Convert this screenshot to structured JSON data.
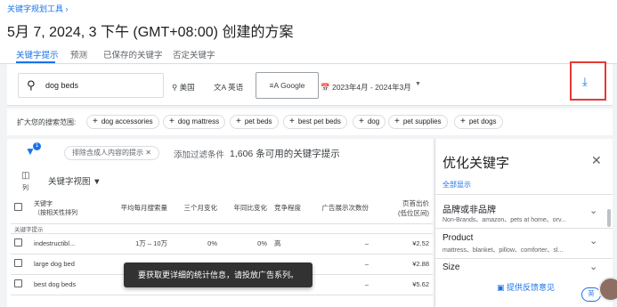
{
  "breadcrumb": "关键字规划工具 ›",
  "page_title": "5月 7, 2024, 3 下午 (GMT+08:00) 创建的方案",
  "tabs": [
    "关键字提示",
    "预测",
    "已保存的关键字",
    "否定关键字"
  ],
  "search": {
    "value": "dog beds",
    "location": "美国",
    "language": "英语",
    "network": "Google",
    "date_range": "2023年4月 - 2024年3月"
  },
  "icons": {
    "search": "search-icon",
    "location": "location-pin-icon",
    "language": "translate-icon",
    "network": "network-icon",
    "calendar": "calendar-icon",
    "download": "download-icon",
    "filter": "filter-icon",
    "columns": "columns-icon"
  },
  "expand": {
    "label": "扩大您的搜索范围:",
    "chips": [
      "dog accessories",
      "dog mattress",
      "pet beds",
      "best pet beds",
      "dog",
      "pet supplies",
      "pet dogs"
    ]
  },
  "filters": {
    "badge": "1",
    "exclude_chip": "排除含成人内容的提示",
    "add_filter": "添加过滤条件",
    "available_count": "1,606 条可用的关键字提示"
  },
  "columns": {
    "icon_label": "列",
    "view_label": "关键字视图"
  },
  "table": {
    "headers": [
      "关键字\n（按相关性排列",
      "平均每月搜索量",
      "三个月变化",
      "年同比变化",
      "竞争程度",
      "广告展示次数份",
      "页首出价\n(低位区间)"
    ],
    "group_label": "关键字提示",
    "rows": [
      {
        "keyword": "indestructibl...",
        "volume": "1万 – 10万",
        "three_month": "0%",
        "yoy": "0%",
        "competition": "高",
        "impr": "–",
        "bid": "¥2.52"
      },
      {
        "keyword": "large dog bed",
        "volume": "",
        "three_month": "",
        "yoy": "",
        "competition": "",
        "impr": "–",
        "bid": "¥2.88"
      },
      {
        "keyword": "best dog beds",
        "volume": "1万 – 10万",
        "three_month": "",
        "yoy": "",
        "competition": "高",
        "impr": "–",
        "bid": "¥5.62"
      }
    ]
  },
  "toast": "要获取更详细的统计信息，请投放广告系列。",
  "sidebar": {
    "title": "优化关键字",
    "show_all": "全部显示",
    "items": [
      {
        "title": "品牌或非品牌",
        "desc": "Non-Brands、amazon、pets at home、orv..."
      },
      {
        "title": "Product",
        "desc": "mattress、blanket、pillow、comforter、sl..."
      },
      {
        "title": "Size",
        "desc": ""
      }
    ],
    "feedback": "提供反馈意见",
    "lang_pill": "英"
  },
  "colors": {
    "accent": "#1a73e8",
    "highlight_box": "#e53935",
    "toast_bg": "#323232"
  }
}
